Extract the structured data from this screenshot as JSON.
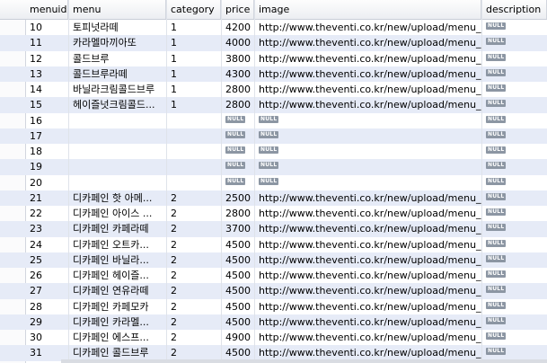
{
  "columns": [
    "menuid",
    "menu",
    "category",
    "price",
    "image",
    "description"
  ],
  "null_label": "NULL",
  "rows": [
    {
      "menuid": "10",
      "menu": "토피넛라떼",
      "category": "1",
      "price": "4200",
      "image": "http://www.theventi.co.kr/new/upload/menu_n...",
      "description": null
    },
    {
      "menuid": "11",
      "menu": "카라멜마끼아또",
      "category": "1",
      "price": "4000",
      "image": "http://www.theventi.co.kr/new/upload/menu_n...",
      "description": null
    },
    {
      "menuid": "12",
      "menu": "콜드브루",
      "category": "1",
      "price": "3800",
      "image": "http://www.theventi.co.kr/new/upload/menu_n...",
      "description": null
    },
    {
      "menuid": "13",
      "menu": "콜드브루라떼",
      "category": "1",
      "price": "4300",
      "image": "http://www.theventi.co.kr/new/upload/menu_n...",
      "description": null
    },
    {
      "menuid": "14",
      "menu": "바닐라크림콜드브루",
      "category": "1",
      "price": "2800",
      "image": "http://www.theventi.co.kr/new/upload/menu_n...",
      "description": null
    },
    {
      "menuid": "15",
      "menu": "헤이즐넛크림콜드...",
      "category": "1",
      "price": "2800",
      "image": "http://www.theventi.co.kr/new/upload/menu_n...",
      "description": null
    },
    {
      "menuid": "16",
      "menu": "",
      "category": "",
      "price": null,
      "image": null,
      "description": null
    },
    {
      "menuid": "17",
      "menu": "",
      "category": "",
      "price": null,
      "image": null,
      "description": null
    },
    {
      "menuid": "18",
      "menu": "",
      "category": "",
      "price": null,
      "image": null,
      "description": null
    },
    {
      "menuid": "19",
      "menu": "",
      "category": "",
      "price": null,
      "image": null,
      "description": null
    },
    {
      "menuid": "20",
      "menu": "",
      "category": "",
      "price": null,
      "image": null,
      "description": null
    },
    {
      "menuid": "21",
      "menu": "디카페인 핫 아메...",
      "category": "2",
      "price": "2500",
      "image": "http://www.theventi.co.kr/new/upload/menu_n...",
      "description": null
    },
    {
      "menuid": "22",
      "menu": "디카페인 아이스 ...",
      "category": "2",
      "price": "2800",
      "image": "http://www.theventi.co.kr/new/upload/menu_n...",
      "description": null
    },
    {
      "menuid": "23",
      "menu": "디카페인 카페라떼",
      "category": "2",
      "price": "3700",
      "image": "http://www.theventi.co.kr/new/upload/menu_n...",
      "description": null
    },
    {
      "menuid": "24",
      "menu": "디카페인 오트카...",
      "category": "2",
      "price": "4500",
      "image": "http://www.theventi.co.kr/new/upload/menu_n...",
      "description": null
    },
    {
      "menuid": "25",
      "menu": "디카페인 바닐라...",
      "category": "2",
      "price": "4500",
      "image": "http://www.theventi.co.kr/new/upload/menu_n...",
      "description": null
    },
    {
      "menuid": "26",
      "menu": "디카페인 헤이즐...",
      "category": "2",
      "price": "4500",
      "image": "http://www.theventi.co.kr/new/upload/menu_n...",
      "description": null
    },
    {
      "menuid": "27",
      "menu": "디카페인 연유라떼",
      "category": "2",
      "price": "4500",
      "image": "http://www.theventi.co.kr/new/upload/menu_n...",
      "description": null
    },
    {
      "menuid": "28",
      "menu": "디카페인 카페모카",
      "category": "2",
      "price": "4500",
      "image": "http://www.theventi.co.kr/new/upload/menu_n...",
      "description": null
    },
    {
      "menuid": "29",
      "menu": "디카페인 카라멜...",
      "category": "2",
      "price": "4500",
      "image": "http://www.theventi.co.kr/new/upload/menu_n...",
      "description": null
    },
    {
      "menuid": "30",
      "menu": "디카페인 에스프...",
      "category": "2",
      "price": "4900",
      "image": "http://www.theventi.co.kr/new/upload/menu_n...",
      "description": null
    },
    {
      "menuid": "31",
      "menu": "디카페인 콜드브루",
      "category": "2",
      "price": "4500",
      "image": "http://www.theventi.co.kr/new/upload/menu_n...",
      "description": null
    }
  ],
  "colors": {
    "row_alt": "#e6ebf7",
    "null_badge": "#8c96a3",
    "header_border": "#c9ced8"
  }
}
